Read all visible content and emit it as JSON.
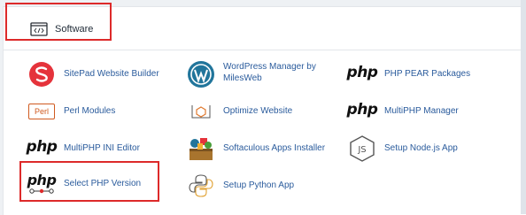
{
  "section": {
    "title": "Software",
    "icon": "code-window-icon"
  },
  "items": [
    {
      "label": "SitePad Website Builder",
      "icon": "sitepad-icon"
    },
    {
      "label_line1": "WordPress Manager by",
      "label_line2": "MilesWeb",
      "icon": "wordpress-icon"
    },
    {
      "label": "PHP PEAR Packages",
      "icon": "php-pear-icon"
    },
    {
      "label": "Perl Modules",
      "icon": "perl-icon"
    },
    {
      "label": "Optimize Website",
      "icon": "optimize-icon"
    },
    {
      "label": "MultiPHP Manager",
      "icon": "multiphp-manager-icon"
    },
    {
      "label": "MultiPHP INI Editor",
      "icon": "multiphp-ini-icon"
    },
    {
      "label": "Softaculous Apps Installer",
      "icon": "softaculous-icon"
    },
    {
      "label": "Setup Node.js App",
      "icon": "nodejs-icon"
    },
    {
      "label": "Select PHP Version",
      "icon": "select-php-icon"
    },
    {
      "label": "Setup Python App",
      "icon": "python-icon"
    }
  ],
  "logo_text": {
    "php": "php",
    "perl": "Perl",
    "js": "JS"
  },
  "colors": {
    "link": "#2a5b9c",
    "highlight": "#dd2a2a",
    "sitepad": "#e5333b",
    "wordpress": "#21759b"
  }
}
